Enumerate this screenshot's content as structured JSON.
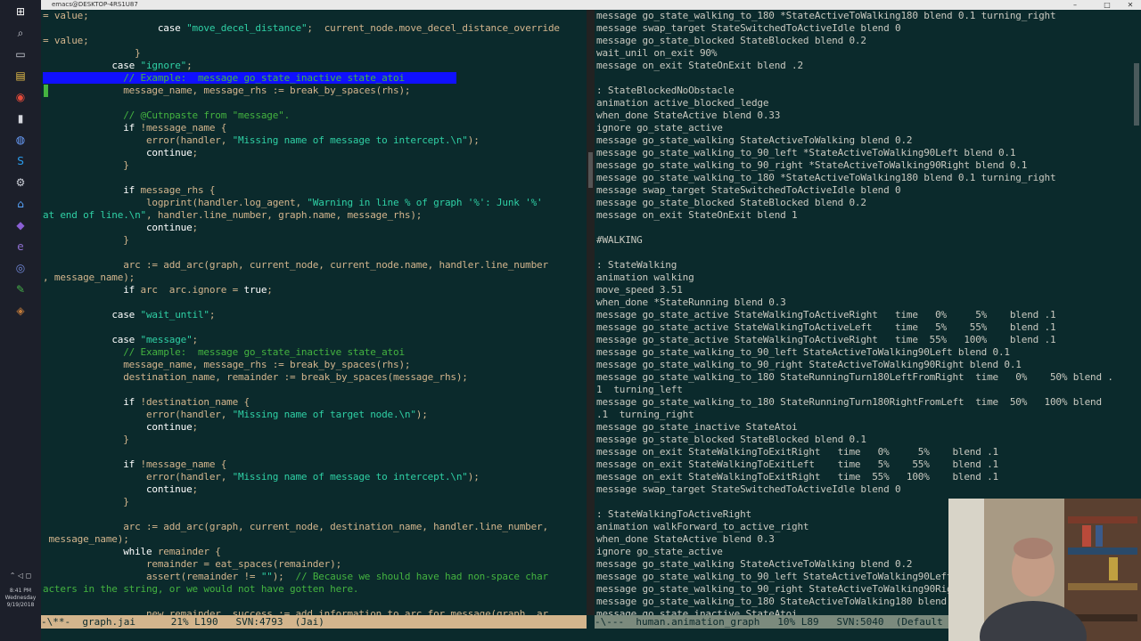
{
  "taskbar": {
    "icons": [
      "windows-start-icon",
      "search-icon",
      "task-view-icon",
      "file-explorer-icon",
      "chrome-icon",
      "terminal-icon",
      "globe-icon",
      "skype-icon",
      "settings-icon",
      "app-icon",
      "visual-studio-icon",
      "emacs-icon",
      "discord-icon",
      "notepad-icon",
      "misc-icon"
    ],
    "clock_time": "8:41 PM",
    "clock_day": "Wednesday",
    "clock_date": "9/19/2018"
  },
  "window": {
    "title": "emacs@DESKTOP-4RS1U87"
  },
  "left_pane": {
    "lines": [
      [
        [
          "",
          "= value;"
        ]
      ],
      [
        [
          "",
          "                    "
        ],
        [
          "kw",
          "case"
        ],
        [
          "",
          " "
        ],
        [
          "str",
          "\"move_decel_distance\""
        ],
        [
          "",
          ";  current_node.move_decel_distance_override"
        ]
      ],
      [
        [
          "",
          "= value;"
        ]
      ],
      [
        [
          "",
          "                }"
        ]
      ],
      [
        [
          "",
          "            "
        ],
        [
          "kw",
          "case"
        ],
        [
          "",
          " "
        ],
        [
          "str",
          "\"ignore\""
        ],
        [
          "",
          ";"
        ]
      ],
      [
        [
          "hl",
          "              // Example:  message go_state_inactive state_atoi         "
        ]
      ],
      [
        [
          "",
          "              message_name, message_rhs := break_by_spaces(rhs);"
        ]
      ],
      [
        [
          "",
          ""
        ]
      ],
      [
        [
          "cm",
          "              // @Cutnpaste from \"message\"."
        ]
      ],
      [
        [
          "",
          "              "
        ],
        [
          "kw",
          "if"
        ],
        [
          "",
          " !message_name {"
        ]
      ],
      [
        [
          "",
          "                  error(handler, "
        ],
        [
          "str",
          "\"Missing name of message to intercept.\\n\""
        ],
        [
          "",
          ");"
        ]
      ],
      [
        [
          "",
          "                  "
        ],
        [
          "kw",
          "continue"
        ],
        [
          "",
          ";"
        ]
      ],
      [
        [
          "",
          "              }"
        ]
      ],
      [
        [
          "",
          ""
        ]
      ],
      [
        [
          "",
          "              "
        ],
        [
          "kw",
          "if"
        ],
        [
          "",
          " message_rhs {"
        ]
      ],
      [
        [
          "",
          "                  logprint(handler.log_agent, "
        ],
        [
          "str",
          "\"Warning in line % of graph '%': Junk '%' "
        ]
      ],
      [
        [
          "str",
          "at end of line.\\n\""
        ],
        [
          "",
          ", handler.line_number, graph.name, message_rhs);"
        ]
      ],
      [
        [
          "",
          "                  "
        ],
        [
          "kw",
          "continue"
        ],
        [
          "",
          ";"
        ]
      ],
      [
        [
          "",
          "              }"
        ]
      ],
      [
        [
          "",
          ""
        ]
      ],
      [
        [
          "",
          "              arc := add_arc(graph, current_node, current_node.name, handler.line_number"
        ]
      ],
      [
        [
          "",
          ", message_name);"
        ]
      ],
      [
        [
          "",
          "              "
        ],
        [
          "kw",
          "if"
        ],
        [
          "",
          " arc  arc.ignore = "
        ],
        [
          "kw",
          "true"
        ],
        [
          "",
          ";"
        ]
      ],
      [
        [
          "",
          ""
        ]
      ],
      [
        [
          "",
          "            "
        ],
        [
          "kw",
          "case"
        ],
        [
          "",
          " "
        ],
        [
          "str",
          "\"wait_until\""
        ],
        [
          "",
          ";"
        ]
      ],
      [
        [
          "",
          ""
        ]
      ],
      [
        [
          "",
          "            "
        ],
        [
          "kw",
          "case"
        ],
        [
          "",
          " "
        ],
        [
          "str",
          "\"message\""
        ],
        [
          "",
          ";"
        ]
      ],
      [
        [
          "cm",
          "              // Example:  message go_state_inactive state_atoi"
        ]
      ],
      [
        [
          "",
          "              message_name, message_rhs := break_by_spaces(rhs);"
        ]
      ],
      [
        [
          "",
          "              destination_name, remainder := break_by_spaces(message_rhs);"
        ]
      ],
      [
        [
          "",
          ""
        ]
      ],
      [
        [
          "",
          "              "
        ],
        [
          "kw",
          "if"
        ],
        [
          "",
          " !destination_name {"
        ]
      ],
      [
        [
          "",
          "                  error(handler, "
        ],
        [
          "str",
          "\"Missing name of target node.\\n\""
        ],
        [
          "",
          ");"
        ]
      ],
      [
        [
          "",
          "                  "
        ],
        [
          "kw",
          "continue"
        ],
        [
          "",
          ";"
        ]
      ],
      [
        [
          "",
          "              }"
        ]
      ],
      [
        [
          "",
          ""
        ]
      ],
      [
        [
          "",
          "              "
        ],
        [
          "kw",
          "if"
        ],
        [
          "",
          " !message_name {"
        ]
      ],
      [
        [
          "",
          "                  error(handler, "
        ],
        [
          "str",
          "\"Missing name of message to intercept.\\n\""
        ],
        [
          "",
          ");"
        ]
      ],
      [
        [
          "",
          "                  "
        ],
        [
          "kw",
          "continue"
        ],
        [
          "",
          ";"
        ]
      ],
      [
        [
          "",
          "              }"
        ]
      ],
      [
        [
          "",
          ""
        ]
      ],
      [
        [
          "",
          "              arc := add_arc(graph, current_node, destination_name, handler.line_number,"
        ]
      ],
      [
        [
          "",
          " message_name);"
        ]
      ],
      [
        [
          "",
          "              "
        ],
        [
          "kw",
          "while"
        ],
        [
          "",
          " remainder {"
        ]
      ],
      [
        [
          "",
          "                  remainder = eat_spaces(remainder);"
        ]
      ],
      [
        [
          "",
          "                  assert(remainder != "
        ],
        [
          "str",
          "\"\""
        ],
        [
          "",
          ");  "
        ],
        [
          "cm",
          "// Because we should have had non-space char"
        ]
      ],
      [
        [
          "cm",
          "acters in the string, or we would not have gotten here."
        ]
      ],
      [
        [
          "",
          ""
        ]
      ],
      [
        [
          "",
          "                  new_remainder, success := add_information_to_arc_for_message(graph, ar"
        ]
      ]
    ]
  },
  "right_pane": {
    "lines": [
      "message go_state_walking_to_180 *StateActiveToWalking180 blend 0.1 turning_right",
      "message swap_target StateSwitchedToActiveIdle blend 0",
      "message go_state_blocked StateBlocked blend 0.2",
      "wait_unil on_exit 90%",
      "message on_exit StateOnExit blend .2",
      "",
      ": StateBlockedNoObstacle",
      "animation active_blocked_ledge",
      "when_done StateActive blend 0.33",
      "ignore go_state_active",
      "message go_state_walking StateActiveToWalking blend 0.2",
      "message go_state_walking_to_90_left *StateActiveToWalking90Left blend 0.1",
      "message go_state_walking_to_90_right *StateActiveToWalking90Right blend 0.1",
      "message go_state_walking_to_180 *StateActiveToWalking180 blend 0.1 turning_right",
      "message swap_target StateSwitchedToActiveIdle blend 0",
      "message go_state_blocked StateBlocked blend 0.2",
      "message on_exit StateOnExit blend 1",
      "",
      "#WALKING",
      "",
      ": StateWalking",
      "animation walking",
      "move_speed 3.51",
      "when_done *StateRunning blend 0.3",
      "message go_state_active StateWalkingToActiveRight   time   0%     5%    blend .1",
      "message go_state_active StateWalkingToActiveLeft    time   5%    55%    blend .1",
      "message go_state_active StateWalkingToActiveRight   time  55%   100%    blend .1",
      "message go_state_walking_to_90_left StateActiveToWalking90Left blend 0.1",
      "message go_state_walking_to_90_right StateActiveToWalking90Right blend 0.1",
      "message go_state_walking_to_180 StateRunningTurn180LeftFromRight  time   0%    50% blend .",
      "1  turning_left",
      "message go_state_walking_to_180 StateRunningTurn180RightFromLeft  time  50%   100% blend",
      ".1  turning_right",
      "message go_state_inactive StateAtoi",
      "message go_state_blocked StateBlocked blend 0.1",
      "message on_exit StateWalkingToExitRight   time   0%     5%    blend .1",
      "message on_exit StateWalkingToExitLeft    time   5%    55%    blend .1",
      "message on_exit StateWalkingToExitRight   time  55%   100%    blend .1",
      "message swap_target StateSwitchedToActiveIdle blend 0",
      "",
      ": StateWalkingToActiveRight",
      "animation walkForward_to_active_right",
      "when_done StateActive blend 0.3",
      "ignore go_state_active",
      "message go_state_walking StateActiveToWalking blend 0.2",
      "message go_state_walking_to_90_left StateActiveToWalking90Left blend 0.1",
      "message go_state_walking_to_90_right StateActiveToWalking90Right blend 0.1",
      "message go_state_walking_to_180 StateActiveToWalking180 blend 0.1 turning_right",
      "message go_state_inactive StateAtoi"
    ]
  },
  "modeline_left": {
    "text": "-\\**-  graph.jai      21% L190   SVN:4793  (Jai)"
  },
  "modeline_right": {
    "text": "-\\---  human.animation_graph   10% L89   SVN:5040  (Default"
  }
}
